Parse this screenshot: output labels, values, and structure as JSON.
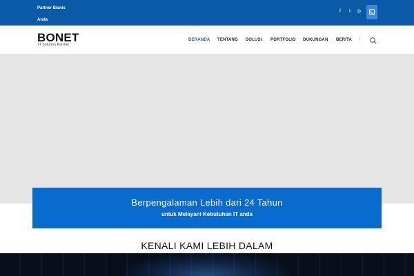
{
  "topbar": {
    "tagline_line1": "Partner Bisnis",
    "tagline_line2": "Anda",
    "social": [
      {
        "icon": "facebook-icon",
        "glyph": "f"
      },
      {
        "icon": "twitter-icon",
        "glyph": "t"
      },
      {
        "icon": "instagram-icon",
        "glyph": "◎"
      }
    ],
    "phone_icon": "phone-icon"
  },
  "header": {
    "logo": "BONET",
    "logo_sub": "IT Solution Partner",
    "nav": [
      {
        "label": "BERANDA",
        "active": true
      },
      {
        "label": "TENTANG",
        "active": false
      },
      {
        "label": "SOLUSI",
        "active": false
      },
      {
        "label": "PORTFOLIO",
        "active": false
      },
      {
        "label": "DUKUNGAN",
        "active": false
      },
      {
        "label": "BERITA",
        "active": false
      }
    ],
    "separator": ":",
    "search_icon": "search-icon"
  },
  "banner": {
    "title": "Berpengalaman Lebih dari 24 Tahun",
    "subtitle": "untuk Melayani Kebutuhan IT anda"
  },
  "section": {
    "title": "KENALI KAMI LEBIH DALAM"
  },
  "colors": {
    "brand_blue": "#0a5aa8",
    "banner_blue": "#0a6bcf",
    "nav_active": "#1a64b8",
    "hero_gray": "#e5e5e5"
  }
}
